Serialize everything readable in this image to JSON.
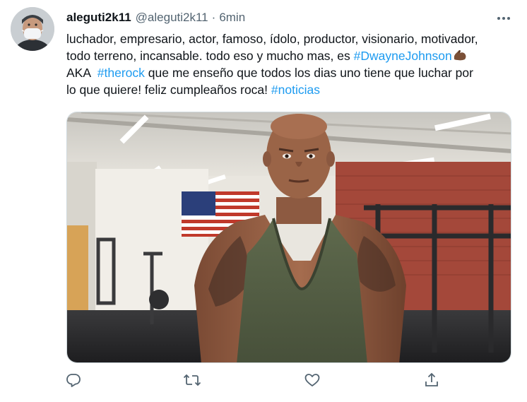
{
  "tweet": {
    "display_name": "aleguti2k11",
    "handle": "@aleguti2k11",
    "separator": "·",
    "time": "6min",
    "body": {
      "line1": "luchador, empresario, actor, famoso, ídolo, productor, visionario, motivador,",
      "line2_prefix": "todo terreno, incansable. todo eso y mucho mas, es ",
      "hashtag1": "#DwayneJohnson",
      "line3_prefix": "AKA  ",
      "hashtag2": "#therock",
      "line3_suffix": " que me enseño que todos los dias uno tiene que luchar por",
      "line4_prefix": "lo que quiere! feliz cumpleaños roca! ",
      "hashtag3": "#noticias"
    },
    "emoji": "flexed-biceps-emoji",
    "colors": {
      "link": "#1d9bf0",
      "text": "#0f1419",
      "muted": "#536471"
    }
  },
  "actions": {
    "reply_icon": "reply-icon",
    "retweet_icon": "retweet-icon",
    "like_icon": "heart-icon",
    "share_icon": "share-icon"
  }
}
